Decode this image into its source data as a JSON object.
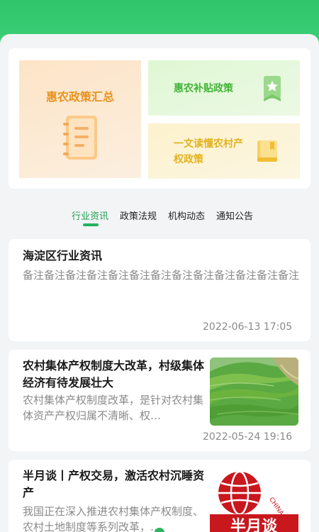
{
  "colors": {
    "brand_green": "#2fc56a",
    "tab_active": "#1e9f52",
    "orange_tile_text": "#e7931f",
    "green_tile_text": "#44b33a",
    "yellow_tile_text": "#e2b21f"
  },
  "features": {
    "policy_summary": {
      "label": "惠农政策汇总",
      "icon": "notebook-icon"
    },
    "subsidy_policy": {
      "label": "惠农补贴政策",
      "icon": "star-badge-icon"
    },
    "property_rights": {
      "label": "一文读懂农村产权政策",
      "icon": "book-icon"
    }
  },
  "tabs": [
    {
      "label": "行业资讯",
      "active": true
    },
    {
      "label": "政策法规",
      "active": false
    },
    {
      "label": "机构动态",
      "active": false
    },
    {
      "label": "通知公告",
      "active": false
    }
  ],
  "news": [
    {
      "title": "海淀区行业资讯",
      "summary": "备注备注备注备注备注备注备注备注备注备注备注备注备注",
      "date": "2022-06-13 17:05"
    },
    {
      "title": "农村集体产权制度大改革，村级集体经济有待发展壮大",
      "summary": "农村集体产权制度改革，是针对农村集体资产产权归属不清晰、权…",
      "date": "2022-05-24 19:16",
      "thumbnail": "rice-terraces-photo"
    },
    {
      "title": "半月谈丨产权交易，激活农村沉睡资产",
      "summary": "我国正在深入推进农村集体产权制度、农村土地制度等系列改革，…",
      "thumbnail": "banyuetan-logo",
      "logo_text": "半月谈",
      "seal_text": "CHINA COMMENT"
    }
  ]
}
